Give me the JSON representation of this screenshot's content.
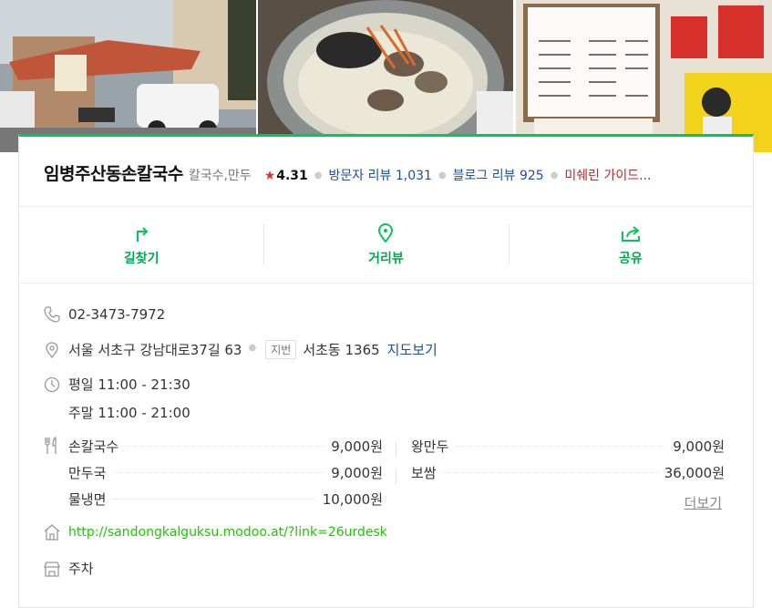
{
  "place": {
    "name": "임병주산동손칼국수",
    "category": "칼국수,만두",
    "rating": "4.31",
    "visitor_reviews": "방문자 리뷰 1,031",
    "blog_reviews": "블로그 리뷰 925",
    "michelin": "미쉐린 가이드..."
  },
  "actions": [
    {
      "label": "길찾기",
      "icon": "directions-icon"
    },
    {
      "label": "거리뷰",
      "icon": "location-pin-icon"
    },
    {
      "label": "공유",
      "icon": "share-icon"
    }
  ],
  "info": {
    "phone": "02-3473-7972",
    "address": "서울 서초구 강남대로37길 63",
    "lot_tag": "지번",
    "lot_address": "서초동 1365",
    "map_link": "지도보기",
    "hours_weekday": "평일 11:00 - 21:30",
    "hours_weekend": "주말 11:00 - 21:00",
    "url": "http://sandongkalguksu.modoo.at/?link=26urdesk",
    "parking": "주차"
  },
  "menu": {
    "items": [
      {
        "name": "손칼국수",
        "price": "9,000원"
      },
      {
        "name": "왕만두",
        "price": "9,000원"
      },
      {
        "name": "만두국",
        "price": "9,000원"
      },
      {
        "name": "보쌈",
        "price": "36,000원"
      },
      {
        "name": "물냉면",
        "price": "10,000원"
      }
    ],
    "more_label": "더보기"
  },
  "photos": [
    "restaurant-exterior-photo",
    "clam-noodle-soup-photo",
    "menu-board-photo"
  ],
  "colors": {
    "accent": "#03c75a",
    "star": "#e03131",
    "review_link": "#1d4f9e",
    "michelin": "#b5292c",
    "url": "#1ec800"
  }
}
